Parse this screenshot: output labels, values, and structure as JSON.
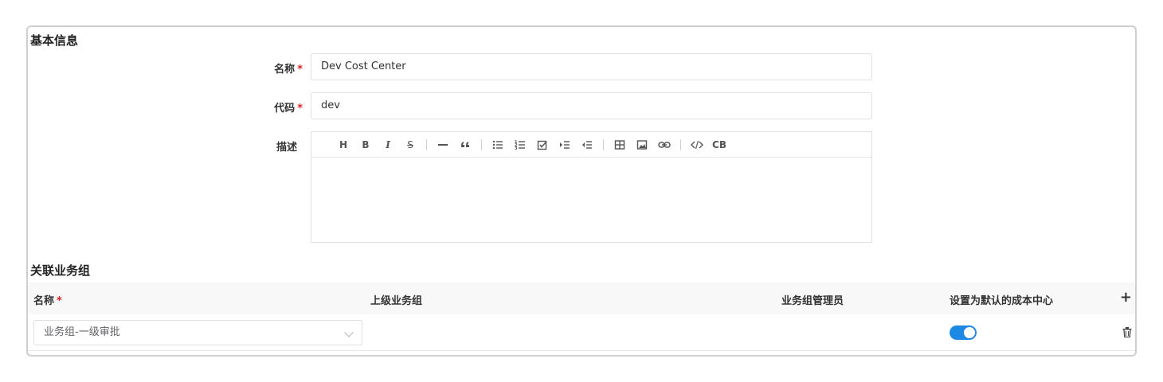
{
  "basic_info": {
    "title": "基本信息",
    "name_label": "名称",
    "name_value": "Dev Cost Center",
    "code_label": "代码",
    "code_value": "dev",
    "desc_label": "描述",
    "required_mark": "*"
  },
  "toolbar": {
    "heading": "H",
    "bold": "B",
    "italic": "I",
    "strike": "S",
    "codeblock": "CB",
    "icons": [
      "heading-icon",
      "bold-icon",
      "italic-icon",
      "strikethrough-icon",
      "horizontal-rule-icon",
      "quote-icon",
      "bullet-list-icon",
      "ordered-list-icon",
      "task-list-icon",
      "indent-icon",
      "outdent-icon",
      "table-icon",
      "image-icon",
      "link-icon",
      "code-icon",
      "code-block-icon"
    ]
  },
  "groups": {
    "title": "关联业务组",
    "columns": [
      "名称",
      "上级业务组",
      "业务组管理员",
      "设置为默认的成本中心"
    ],
    "add_label": "+",
    "rows": [
      {
        "name": "业务组-一级审批",
        "parent": "",
        "admin": "",
        "is_default": true
      }
    ]
  },
  "colors": {
    "accent": "#1e88e5",
    "required": "#e02020"
  }
}
